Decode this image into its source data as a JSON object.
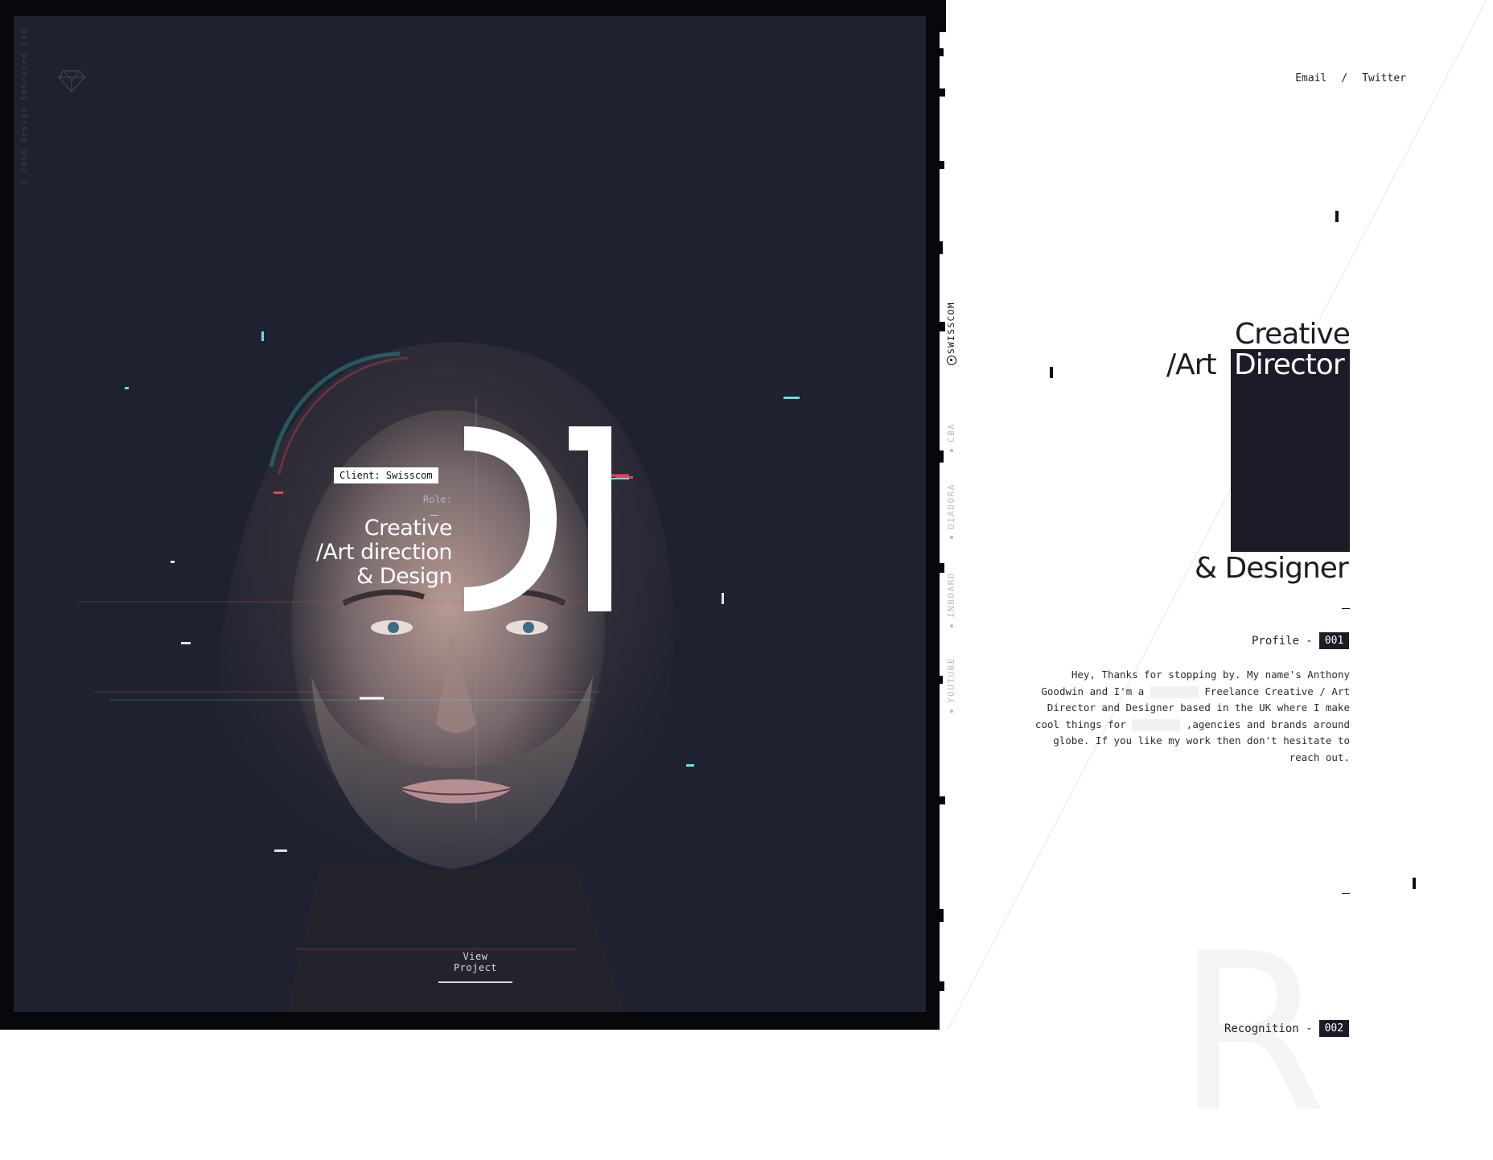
{
  "sidebar_copyright": "© 2016 Design Embraced Ltd",
  "hero": {
    "client_label": "Client: Swisscom",
    "role_label": "Role:",
    "role_lines": [
      "Creative",
      "/Art direction",
      "& Design"
    ],
    "project_number": "01",
    "view_project": "View Project"
  },
  "nav": {
    "items": [
      {
        "label": "SWISSCOM",
        "active": true
      },
      {
        "label": "CBA",
        "active": false
      },
      {
        "label": "DIADORA",
        "active": false
      },
      {
        "label": "INBOARD",
        "active": false
      },
      {
        "label": "YOUTUBE",
        "active": false
      }
    ]
  },
  "header": {
    "email": "Email",
    "separator": "/",
    "twitter": "Twitter"
  },
  "title": {
    "line1": "Creative",
    "line2_prefix": "/Art",
    "line2_highlight": "Director",
    "line3": "& Designer"
  },
  "profile": {
    "label": "Profile -",
    "number": "001",
    "text_part1": "Hey, Thanks for stopping by. My name's Anthony Goodwin and I'm a",
    "text_part2": "Freelance Creative / Art Director and Designer based in the UK where I make cool things for",
    "text_part3": ",agencies and brands around globe. If you like my work then don't hesitate to reach out."
  },
  "recognition": {
    "label": "Recognition -",
    "number": "002",
    "big_letter": "R"
  },
  "colors": {
    "dark_panel": "#1e2130",
    "frame": "#07080b",
    "accent_dark": "#1b1c28",
    "glitch_cyan": "#5fe3e6",
    "glitch_red": "#e2465a"
  }
}
